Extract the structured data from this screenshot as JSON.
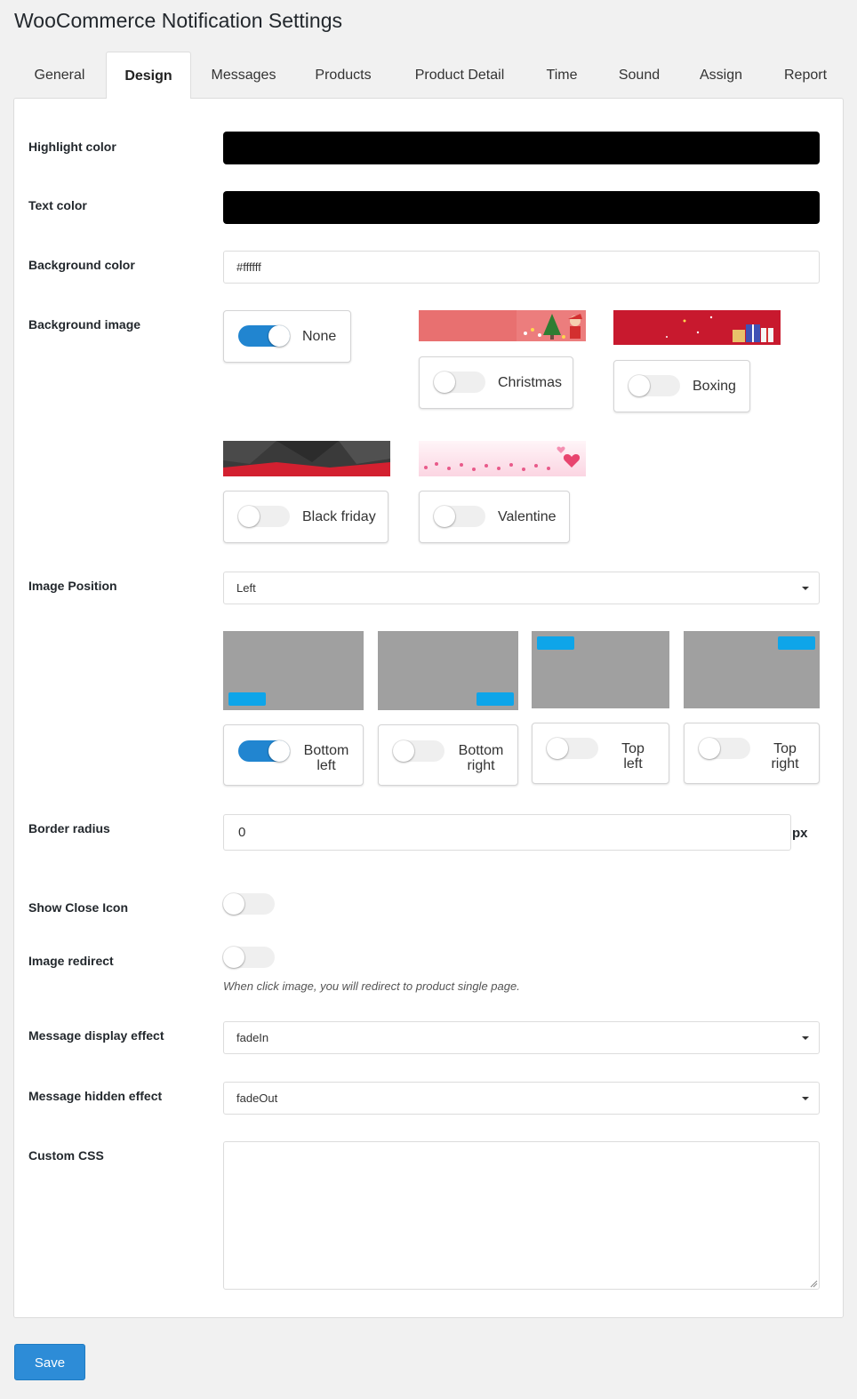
{
  "page": {
    "title": "WooCommerce Notification Settings"
  },
  "tabs": [
    "General",
    "Design",
    "Messages",
    "Products",
    "Product Detail",
    "Time",
    "Sound",
    "Assign",
    "Report"
  ],
  "active_tab": "Design",
  "fields": {
    "highlight_color": {
      "label": "Highlight color",
      "value": "#000000"
    },
    "text_color": {
      "label": "Text color",
      "value": "#000000"
    },
    "background_color": {
      "label": "Background color",
      "value": "#ffffff"
    },
    "background_image": {
      "label": "Background image",
      "options": [
        {
          "label": "None",
          "on": true
        },
        {
          "label": "Christmas",
          "on": false
        },
        {
          "label": "Boxing",
          "on": false
        },
        {
          "label": "Black friday",
          "on": false
        },
        {
          "label": "Valentine",
          "on": false
        }
      ]
    },
    "image_position": {
      "label": "Image Position",
      "value": "Left",
      "options": [
        {
          "line1": "Bottom",
          "line2": "left",
          "on": true
        },
        {
          "line1": "Bottom",
          "line2": "right",
          "on": false
        },
        {
          "line1": "Top",
          "line2": "left",
          "on": false
        },
        {
          "line1": "Top",
          "line2": "right",
          "on": false
        }
      ]
    },
    "border_radius": {
      "label": "Border radius",
      "value": "0",
      "unit": "px"
    },
    "show_close_icon": {
      "label": "Show Close Icon",
      "on": false
    },
    "image_redirect": {
      "label": "Image redirect",
      "on": false,
      "hint": "When click image, you will redirect to product single page."
    },
    "message_display_effect": {
      "label": "Message display effect",
      "value": "fadeIn"
    },
    "message_hidden_effect": {
      "label": "Message hidden effect",
      "value": "fadeOut"
    },
    "custom_css": {
      "label": "Custom CSS",
      "value": ""
    }
  },
  "actions": {
    "save_label": "Save"
  },
  "colors": {
    "accent": "#2185d0",
    "save": "#2d8cd7",
    "marker": "#0ea5e9",
    "preview": "#a0a0a0"
  }
}
